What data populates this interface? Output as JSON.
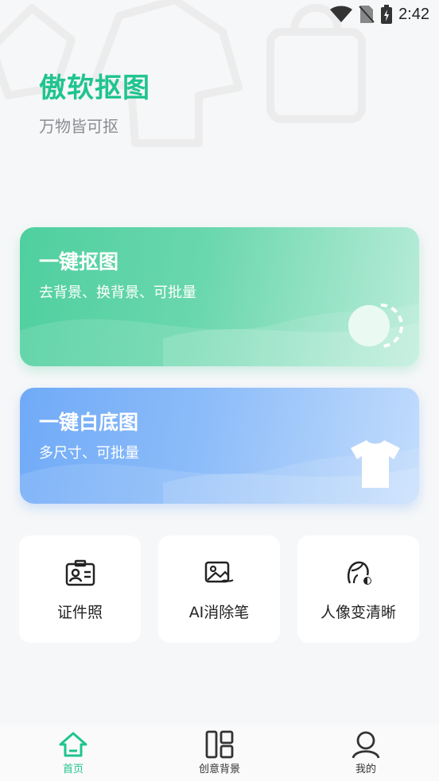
{
  "status_bar": {
    "time": "2:42"
  },
  "header": {
    "title": "傲软抠图",
    "subtitle": "万物皆可抠"
  },
  "cards": [
    {
      "title": "一键抠图",
      "desc": "去背景、换背景、可批量"
    },
    {
      "title": "一键白底图",
      "desc": "多尺寸、可批量"
    }
  ],
  "tools": [
    {
      "label": "证件照",
      "icon": "id-card-icon"
    },
    {
      "label": "AI消除笔",
      "icon": "image-eraser-icon"
    },
    {
      "label": "人像变清晰",
      "icon": "portrait-enhance-icon"
    }
  ],
  "nav": [
    {
      "label": "首页",
      "icon": "home-icon",
      "active": true
    },
    {
      "label": "创意背景",
      "icon": "layout-icon",
      "active": false
    },
    {
      "label": "我的",
      "icon": "profile-icon",
      "active": false
    }
  ],
  "colors": {
    "brand": "#1fc48f",
    "cutout_card": "#4fcf9f",
    "white_bg_card": "#70aaf7"
  }
}
